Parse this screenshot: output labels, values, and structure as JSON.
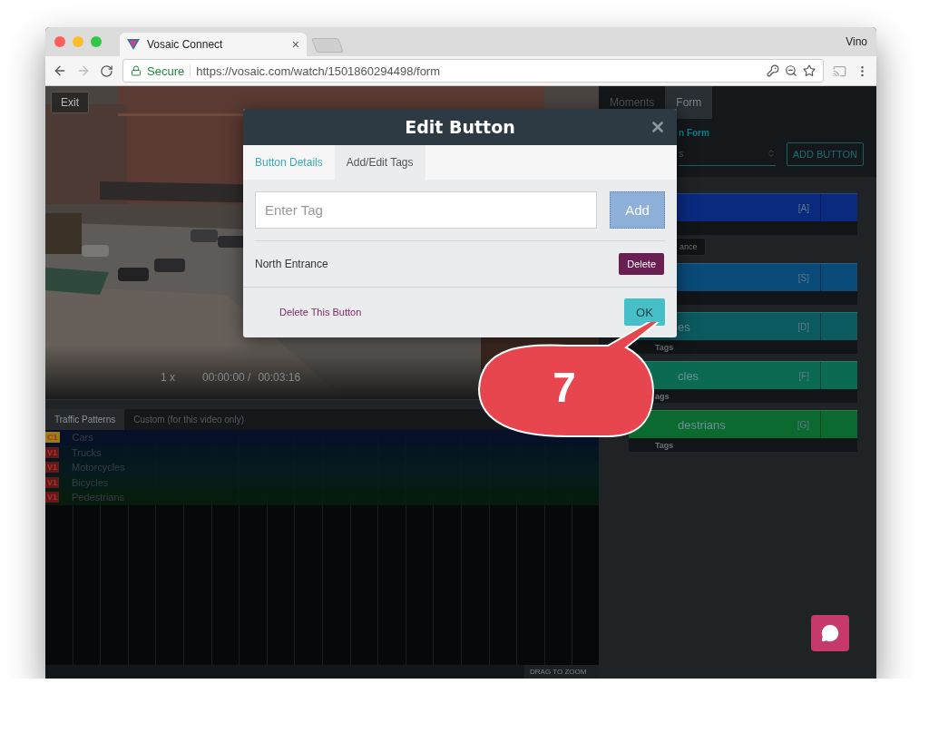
{
  "browser": {
    "tab_title": "Vosaic Connect",
    "tab_close": "×",
    "user": "Vino",
    "secure_label": "Secure",
    "url": "https://vosaic.com/watch/1501860294498/form"
  },
  "video": {
    "exit": "Exit",
    "speed": "1 x",
    "current_time": "00:00:00 /",
    "duration": "00:03:16"
  },
  "timeline": {
    "tabs": [
      {
        "label": "Traffic Patterns",
        "selected": true
      },
      {
        "label": "Custom (for this video only)",
        "selected": false
      }
    ],
    "rows": [
      {
        "badge": {
          "text": "C1",
          "color": "#a8891c"
        },
        "name": "Cars",
        "color": "#06122a"
      },
      {
        "badge": {
          "text": "V1",
          "color": "#6e1a1a"
        },
        "name": "Trucks",
        "color": "#061824"
      },
      {
        "badge": {
          "text": "V1",
          "color": "#6e1a1a"
        },
        "name": "Motorcycles",
        "color": "#061c1f"
      },
      {
        "badge": {
          "text": "V1",
          "color": "#6e1a1a"
        },
        "name": "Bicycles",
        "color": "#061d18"
      },
      {
        "badge": {
          "text": "V1",
          "color": "#6e1a1a"
        },
        "name": "Pedestrians",
        "color": "#071d10"
      }
    ],
    "zoom_hint": "DRAG TO ZOOM"
  },
  "side_panel": {
    "tabs": [
      {
        "label": "Moments",
        "selected": false
      },
      {
        "label": "Form",
        "selected": true
      }
    ],
    "form_label": "n Form",
    "select_value": "s",
    "add_button": "ADD BUTTON",
    "buttons": [
      {
        "key": "[A]",
        "color": "#0a2a80",
        "chips": [
          "ance"
        ]
      },
      {
        "key": "[S]",
        "color": "#0a4a78"
      },
      {
        "name": "es",
        "key": "[D]",
        "color": "#0b5a5f",
        "tags_label": "Tags"
      },
      {
        "name": "cles",
        "key": "[F]",
        "color": "#0a6a52",
        "tags_label": "ags"
      },
      {
        "name": "destrians",
        "key": "[G]",
        "color": "#0a6a30",
        "tags_label": "Tags"
      }
    ]
  },
  "modal": {
    "title": "Edit Button",
    "tabs": [
      {
        "label": "Button Details",
        "selected": false
      },
      {
        "label": "Add/Edit Tags",
        "selected": true
      }
    ],
    "tag_input": {
      "placeholder": "Enter Tag"
    },
    "add_button": "Add",
    "tags": [
      {
        "label": "North Entrance",
        "delete": "Delete"
      }
    ],
    "delete_link": "Delete This Button",
    "ok_button": "OK"
  },
  "callout": {
    "number": "7"
  }
}
